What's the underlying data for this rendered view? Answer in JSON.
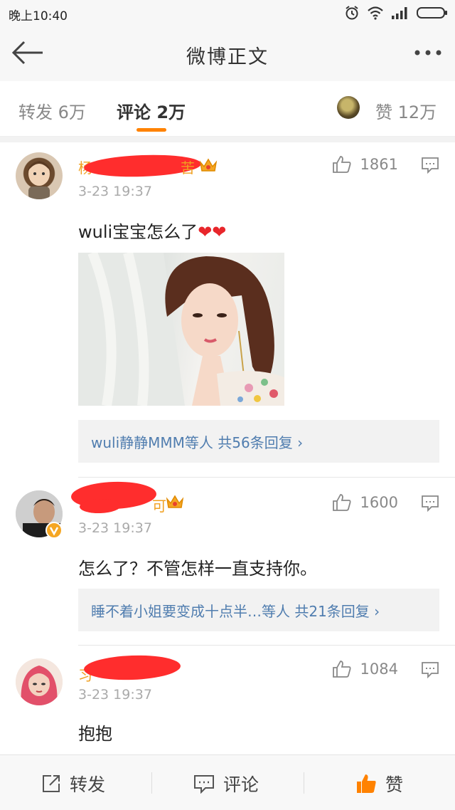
{
  "status_bar": {
    "time": "晚上10:40"
  },
  "nav": {
    "title": "微博正文"
  },
  "tabs": {
    "repost": "转发 6万",
    "comment": "评论 2万",
    "like": "赞 12万"
  },
  "comments": [
    {
      "username_edge_left": "杨",
      "username_edge_right": "苦",
      "time": "3-23 19:37",
      "text": "wuli宝宝怎么了",
      "emoji": "❤❤",
      "likes": "1861",
      "replies": "wuli静静MMM等人  共56条回复 ›"
    },
    {
      "username_edge_left": "",
      "username_edge_right": "可",
      "time": "3-23 19:37",
      "text": "怎么了？不管怎样一直支持你。",
      "emoji": "",
      "likes": "1600",
      "replies": "睡不着小姐要变成十点半…等人  共21条回复 ›"
    },
    {
      "username_edge_left": "习",
      "username_edge_right": "",
      "time": "3-23 19:37",
      "text": "抱抱",
      "emoji": "",
      "likes": "1084",
      "replies": ""
    }
  ],
  "bottom": {
    "repost": "转发",
    "comment": "评论",
    "like": "赞"
  },
  "colors": {
    "accent": "#ff8200",
    "link": "#507daf",
    "redaction": "#ff2d2d"
  }
}
